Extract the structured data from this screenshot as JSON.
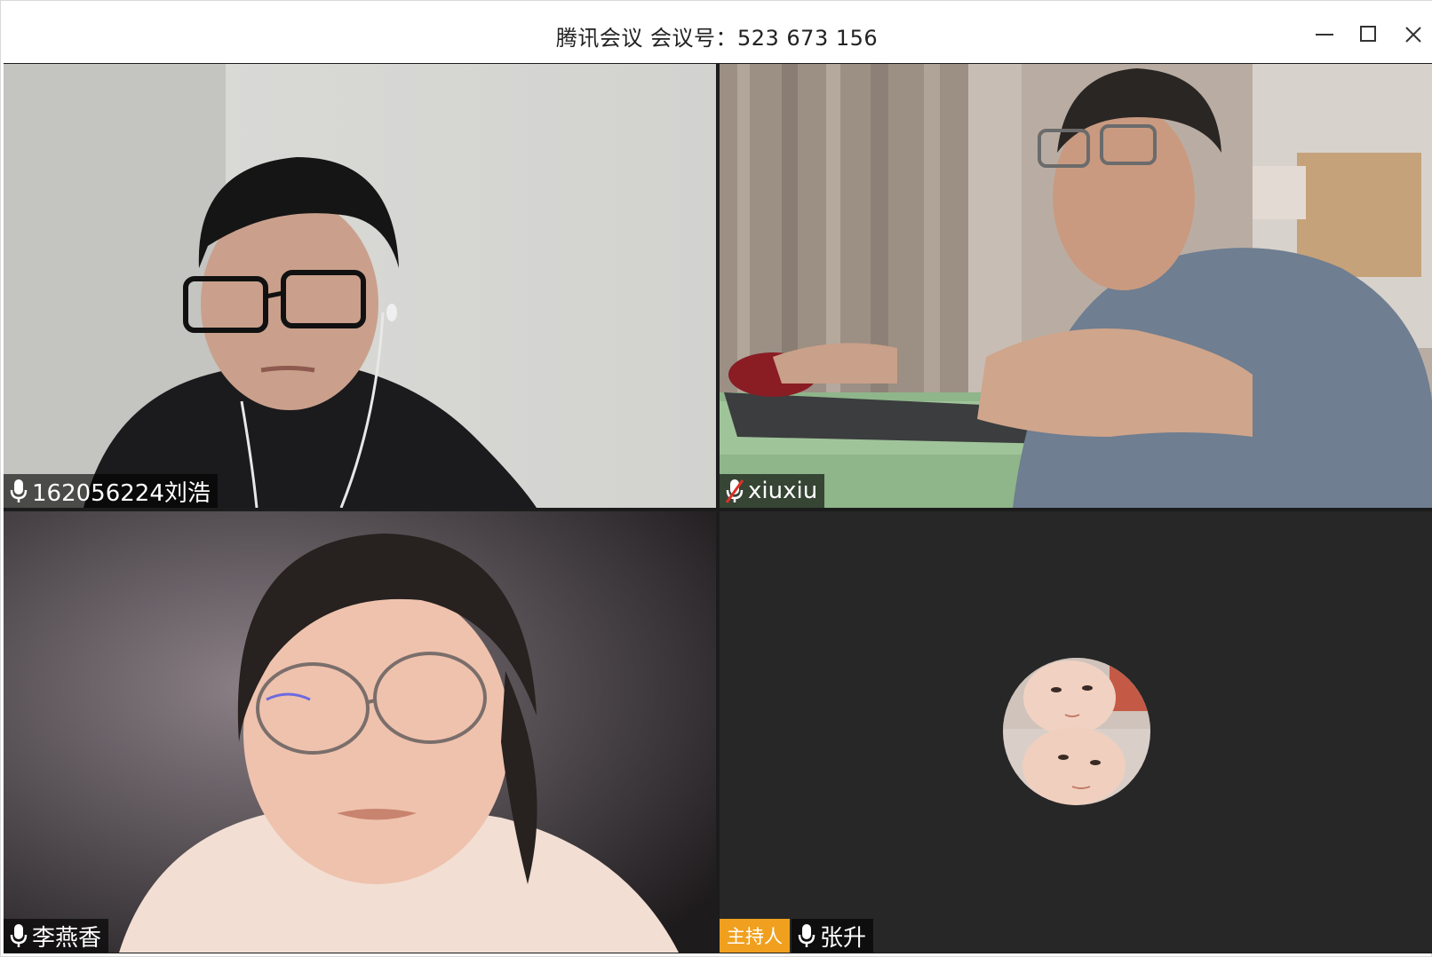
{
  "window": {
    "title": "腾讯会议 会议号：523 673 156",
    "buttons": [
      "minimize",
      "maximize",
      "close"
    ]
  },
  "participants": [
    {
      "name": "162056224刘浩",
      "mic": "on",
      "video": "on",
      "host": false
    },
    {
      "name": "xiuxiu",
      "mic": "muted",
      "video": "on",
      "host": false
    },
    {
      "name": "李燕香",
      "mic": "on",
      "video": "on",
      "host": false
    },
    {
      "name": "张升",
      "mic": "on",
      "video": "off",
      "host": true,
      "host_label": "主持人",
      "avatar": "two-babies-photo"
    }
  ],
  "colors": {
    "host_badge": "#f0a01e",
    "name_bg": "rgba(0,0,0,0.62)",
    "tile_off_bg": "#272727",
    "muted_slash": "#e0302a"
  }
}
